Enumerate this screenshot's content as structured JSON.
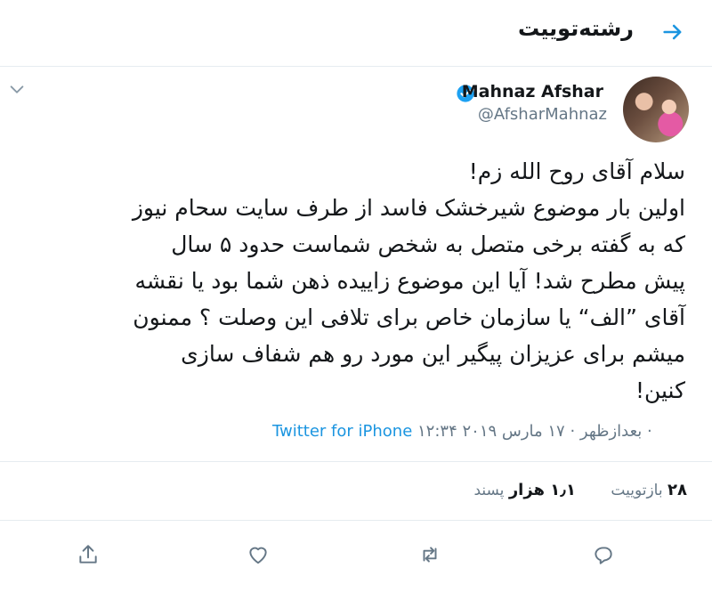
{
  "header": {
    "title": "رشته‌توییت",
    "back_icon": "back-arrow-icon"
  },
  "tweet": {
    "author_name": "Mahnaz Afshar",
    "author_handle": "@AfsharMahnaz",
    "verified": true,
    "text_lines": [
      "سلام آقای روح الله زم!",
      "اولین بار موضوع شیرخشک فاسد از طرف سایت سحام نیوز",
      "که به گفته برخی متصل به شخص شماست حدود ۵ سال",
      "پیش مطرح شد! آیا این موضوع زاییده ذهن شما بود یا نقشه",
      "آقای ”الف“ یا سازمان خاص برای تلافی این وصلت ؟ ممنون",
      "میشم برای عزیزان پیگیر این مورد رو هم شفاف سازی",
      "کنین!"
    ],
    "timestamp": "۱۲:۳۴ بعدازظهر · ۱۷ مارس ۲۰۱۹ ·",
    "source": "Twitter for iPhone"
  },
  "stats": {
    "retweets_count": "۲۸",
    "retweets_label": "بازتوییت",
    "likes_count": "۱٫۱ هزار",
    "likes_label": "پسند"
  },
  "actions": [
    "reply-icon",
    "retweet-icon",
    "like-icon",
    "share-icon"
  ],
  "colors": {
    "accent": "#1b95e0",
    "secondary_text": "#657786",
    "divider": "#e6ecf0"
  }
}
